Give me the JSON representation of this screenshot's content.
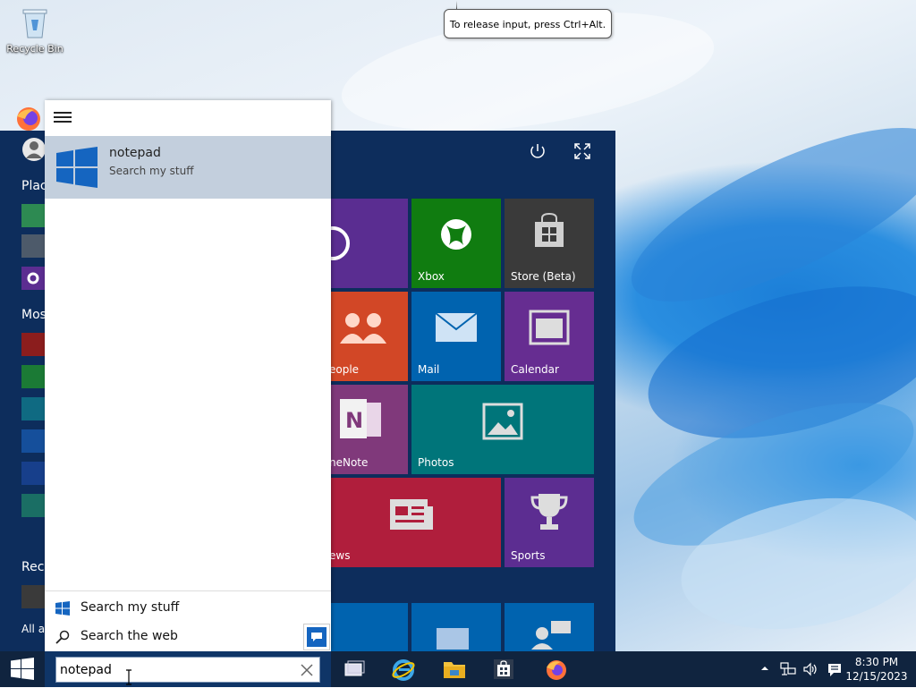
{
  "desktop": {
    "recycle_bin_label": "Recycle Bin",
    "tooltip_text": "To release input, press Ctrl+Alt."
  },
  "start_menu": {
    "left_labels": [
      "Plac",
      "Mos",
      "Rece",
      "All ap"
    ],
    "tiles": [
      {
        "label": "Xbox",
        "icon": "xbox-icon",
        "color": "#107c10"
      },
      {
        "label": "Store (Beta)",
        "icon": "store-icon",
        "color": "#3a3a3a"
      },
      {
        "label": "eople",
        "icon": "people-icon",
        "color": "#d24726"
      },
      {
        "label": "Mail",
        "icon": "mail-icon",
        "color": "#0063af"
      },
      {
        "label": "Calendar",
        "icon": "calendar-icon",
        "color": "#662d91"
      },
      {
        "label": "neNote",
        "icon": "onenote-icon",
        "color": "#80397b"
      },
      {
        "label": "Photos",
        "icon": "photos-icon",
        "color": "#00757a"
      },
      {
        "label": "ews",
        "icon": "news-icon",
        "color": "#b01e3c"
      },
      {
        "label": "Sports",
        "icon": "trophy-icon",
        "color": "#5c2d91"
      }
    ]
  },
  "search_panel": {
    "result": {
      "name": "notepad",
      "subtitle": "Search my stuff",
      "icon": "windows-logo-icon"
    },
    "footer": {
      "search_my_stuff": "Search my stuff",
      "search_the_web": "Search the web"
    }
  },
  "taskbar": {
    "search_value": "notepad",
    "pinned": [
      "task-view-icon",
      "internet-explorer-icon",
      "file-explorer-icon",
      "store-icon",
      "firefox-icon"
    ],
    "clock": {
      "time": "8:30 PM",
      "date": "12/15/2023"
    }
  },
  "colors": {
    "taskbar": "#10243f",
    "start_back": "#0d2d5c",
    "result_highlight": "#c3cfdd",
    "windows_blue": "#1565c0"
  }
}
